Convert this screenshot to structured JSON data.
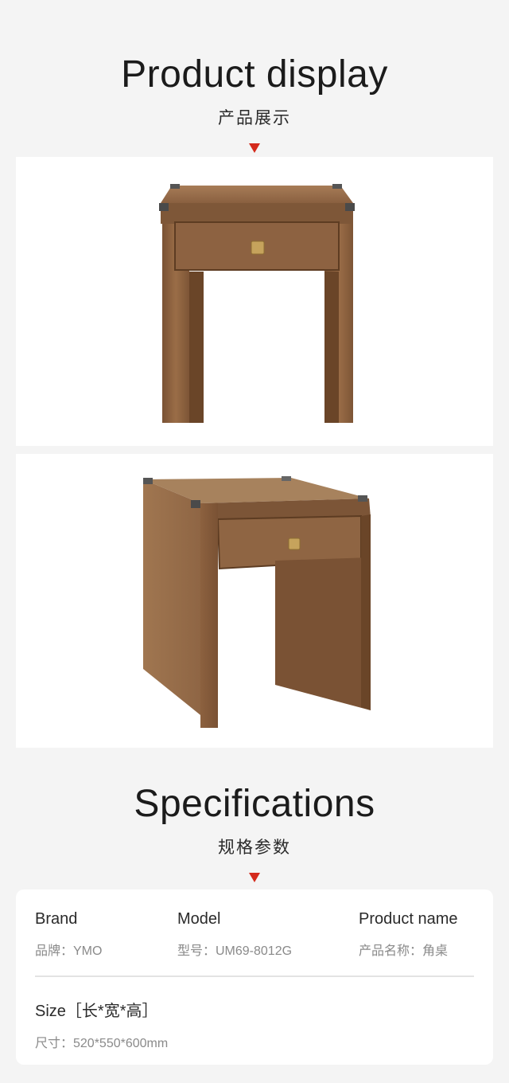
{
  "display": {
    "title_en": "Product display",
    "title_cn": "产品展示",
    "photos": [
      {
        "name": "front-view",
        "alt": "side table front view"
      },
      {
        "name": "angle-view",
        "alt": "side table angled view"
      }
    ]
  },
  "specs": {
    "title_en": "Specifications",
    "title_cn": "规格参数",
    "brand": {
      "label": "Brand",
      "value": "品牌：YMO"
    },
    "model": {
      "label": "Model",
      "value": "型号：UM69-8012G"
    },
    "product_name": {
      "label": "Product name",
      "value": "产品名称：角桌"
    },
    "size": {
      "label": "Size［长*宽*高］",
      "value": "尺寸：520*550*600mm"
    }
  },
  "colors": {
    "accent": "#d42a1c",
    "wood": "#8a5e3b",
    "background": "#f4f4f4"
  }
}
